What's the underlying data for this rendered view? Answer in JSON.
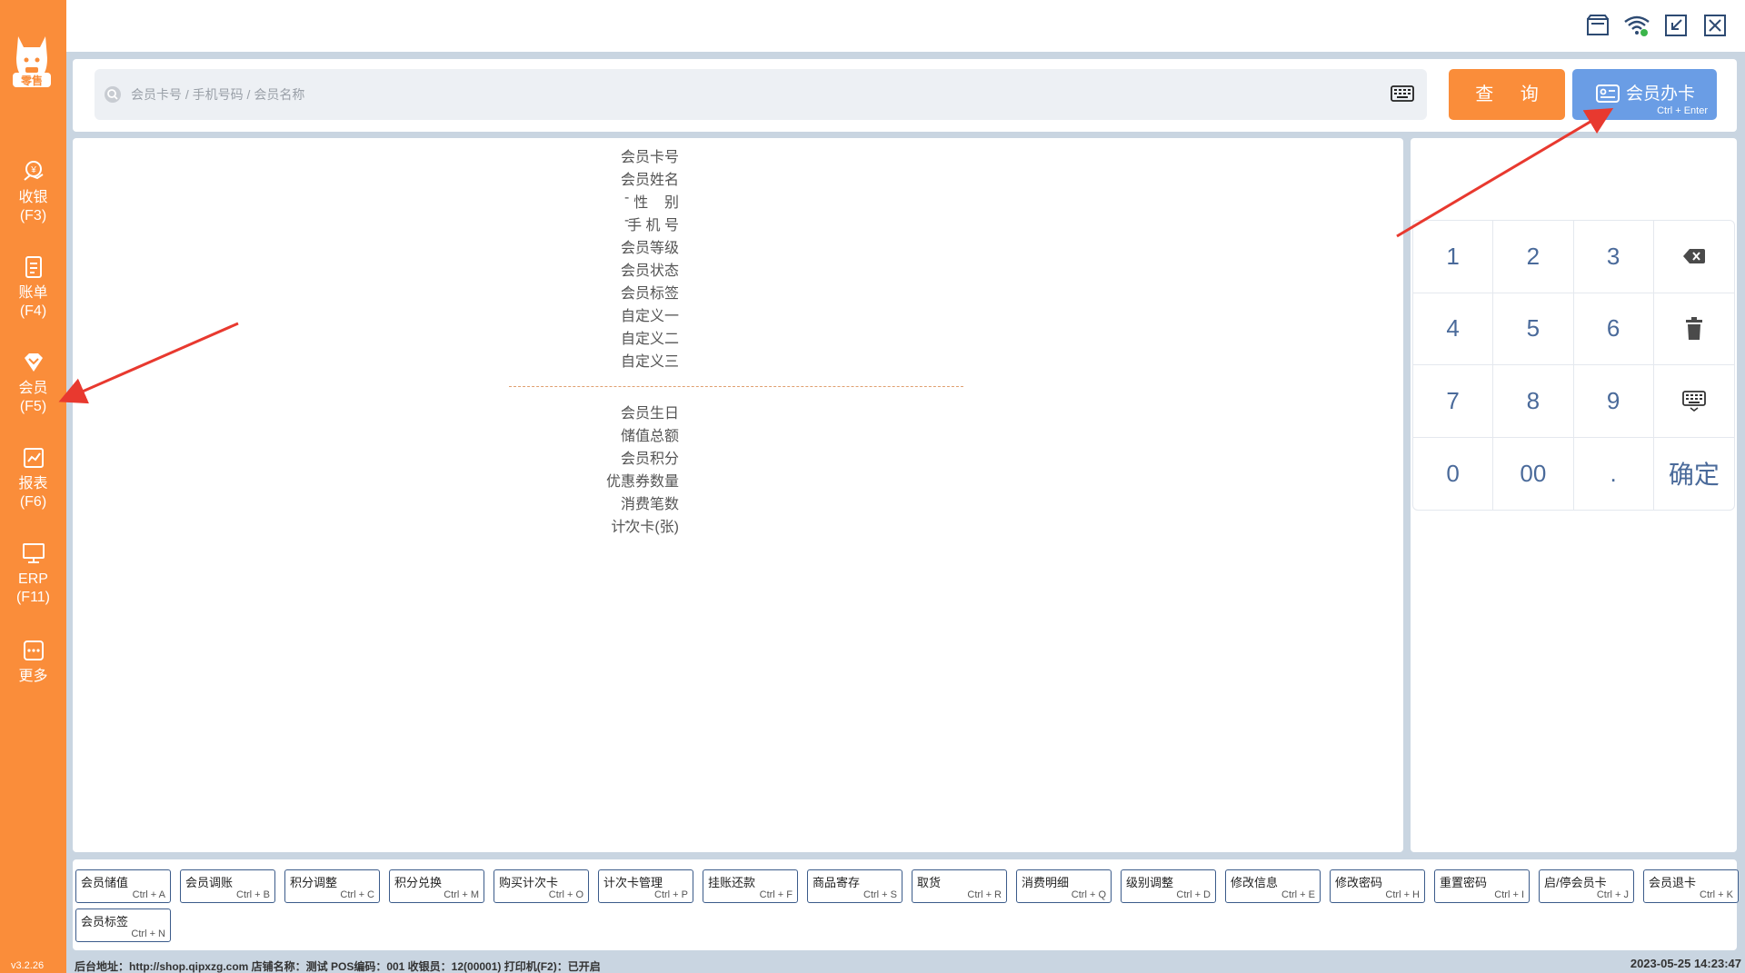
{
  "app": {
    "logo_text": "零售",
    "version": "v3.2.26"
  },
  "sidebar": {
    "items": [
      {
        "label": "收银",
        "shortcut": "(F3)",
        "icon": "cashier-icon"
      },
      {
        "label": "账单",
        "shortcut": "(F4)",
        "icon": "bill-icon"
      },
      {
        "label": "会员",
        "shortcut": "(F5)",
        "icon": "member-icon"
      },
      {
        "label": "报表",
        "shortcut": "(F6)",
        "icon": "report-icon"
      },
      {
        "label": "ERP",
        "shortcut": "(F11)",
        "icon": "erp-icon"
      },
      {
        "label": "更多",
        "shortcut": "",
        "icon": "more-icon"
      }
    ],
    "active": "会员"
  },
  "window_controls": [
    "store-icon",
    "wifi-icon",
    "shrink-icon",
    "close-icon"
  ],
  "search": {
    "placeholder": "会员卡号 / 手机号码 / 会员名称",
    "value": "",
    "query_label": "查 询",
    "card_label": "会员办卡",
    "card_shortcut": "Ctrl + Enter"
  },
  "member_info": {
    "fields": [
      {
        "label": "会员卡号",
        "value": "-"
      },
      {
        "label": "会员姓名",
        "value": "-"
      },
      {
        "label": "性    别",
        "value": "-"
      },
      {
        "label": "手 机 号",
        "value": "-"
      },
      {
        "label": "会员等级",
        "value": "-"
      },
      {
        "label": "会员状态",
        "value": "-"
      },
      {
        "label": "会员标签",
        "value": "-"
      },
      {
        "label": "自定义一",
        "value": "-"
      },
      {
        "label": "自定义二",
        "value": "-"
      },
      {
        "label": "自定义三",
        "value": "-"
      }
    ],
    "stats": [
      {
        "label": "会员生日",
        "value": "-"
      },
      {
        "label": "储值总额",
        "value": "-"
      },
      {
        "label": "会员积分",
        "value": "-"
      },
      {
        "label": "优惠券数量",
        "value": "-"
      },
      {
        "label": "消费笔数",
        "value": "-"
      },
      {
        "label": "计次卡(张)",
        "value": "-"
      }
    ]
  },
  "keypad": {
    "keys": [
      "1",
      "2",
      "3",
      "backspace",
      "4",
      "5",
      "6",
      "delete",
      "7",
      "8",
      "9",
      "keyboard",
      "0",
      "00",
      ".",
      "确定"
    ]
  },
  "shortcuts": [
    {
      "label": "会员储值",
      "key": "Ctrl + A"
    },
    {
      "label": "会员调账",
      "key": "Ctrl + B"
    },
    {
      "label": "积分调整",
      "key": "Ctrl + C"
    },
    {
      "label": "积分兑换",
      "key": "Ctrl + M"
    },
    {
      "label": "购买计次卡",
      "key": "Ctrl + O"
    },
    {
      "label": "计次卡管理",
      "key": "Ctrl + P"
    },
    {
      "label": "挂账还款",
      "key": "Ctrl + F"
    },
    {
      "label": "商品寄存",
      "key": "Ctrl + S"
    },
    {
      "label": "取货",
      "key": "Ctrl + R"
    },
    {
      "label": "消费明细",
      "key": "Ctrl + Q"
    },
    {
      "label": "级别调整",
      "key": "Ctrl + D"
    },
    {
      "label": "修改信息",
      "key": "Ctrl + E"
    },
    {
      "label": "修改密码",
      "key": "Ctrl + H"
    },
    {
      "label": "重置密码",
      "key": "Ctrl + I"
    },
    {
      "label": "启/停会员卡",
      "key": "Ctrl + J"
    },
    {
      "label": "会员退卡",
      "key": "Ctrl + K"
    },
    {
      "label": "会员标签",
      "key": "Ctrl + N"
    }
  ],
  "status": {
    "text": "后台地址：http://shop.qipxzg.com  店铺名称：测试  POS编码：001  收银员：12(00001)  打印机(F2)：已开启",
    "datetime": "2023-05-25 14:23:47"
  },
  "colors": {
    "accent": "#fa8d3a",
    "primary": "#6a9de5",
    "background": "#c9d5e1",
    "annotation": "#e8392f"
  }
}
